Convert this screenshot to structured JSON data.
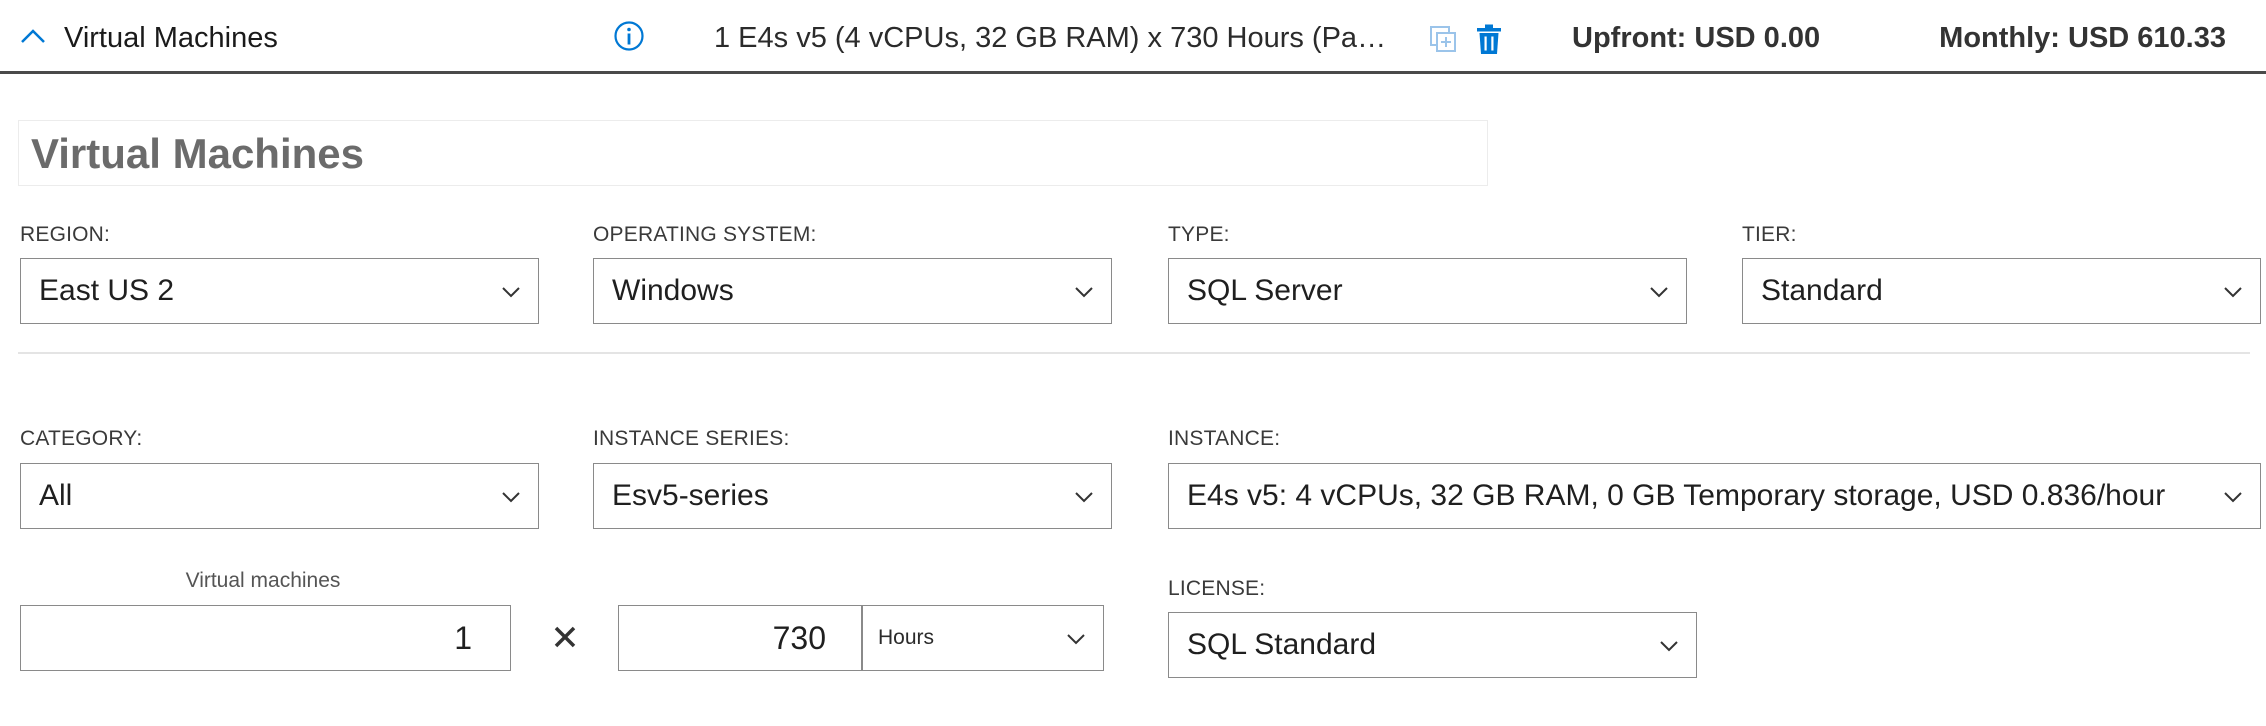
{
  "header": {
    "title": "Virtual Machines",
    "summary": "1 E4s v5 (4 vCPUs, 32 GB RAM) x 730 Hours (Pay as ...",
    "upfront": "Upfront: USD 0.00",
    "monthly": "Monthly: USD 610.33",
    "accent_color": "#0078d4"
  },
  "section": {
    "title": "Virtual Machines"
  },
  "fields": {
    "region": {
      "label": "REGION:",
      "value": "East US 2"
    },
    "os": {
      "label": "OPERATING SYSTEM:",
      "value": "Windows"
    },
    "type": {
      "label": "TYPE:",
      "value": "SQL Server"
    },
    "tier": {
      "label": "TIER:",
      "value": "Standard"
    },
    "category": {
      "label": "CATEGORY:",
      "value": "All"
    },
    "series": {
      "label": "INSTANCE SERIES:",
      "value": "Esv5-series"
    },
    "instance": {
      "label": "INSTANCE:",
      "value": "E4s v5: 4 vCPUs, 32 GB RAM, 0 GB Temporary storage, USD 0.836/hour"
    },
    "license": {
      "label": "LICENSE:",
      "value": "SQL Standard"
    }
  },
  "quantity": {
    "caption": "Virtual machines",
    "vm_count": "1",
    "hours": "730",
    "unit": "Hours"
  },
  "icons": {
    "collapse": "chevron-up-icon",
    "info": "info-icon",
    "clone": "clone-icon",
    "delete": "trash-icon",
    "dropdown": "chevron-down-icon",
    "multiply": "times-icon"
  }
}
